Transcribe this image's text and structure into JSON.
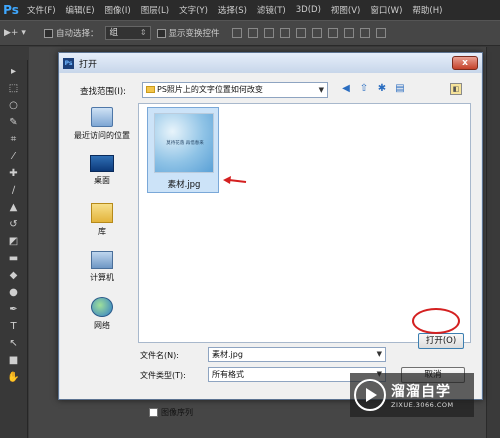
{
  "app": {
    "logo": "Ps",
    "menu": [
      "文件(F)",
      "编辑(E)",
      "图像(I)",
      "图层(L)",
      "文字(Y)",
      "选择(S)",
      "滤镜(T)",
      "3D(D)",
      "视图(V)",
      "窗口(W)",
      "帮助(H)"
    ]
  },
  "options": {
    "tool": "▶+ ▾",
    "auto_select_label": "自动选择：",
    "auto_select_value": "组",
    "show_transform_label": "显示变换控件"
  },
  "tools": [
    "move-icon",
    "marquee-icon",
    "lasso-icon",
    "quick-select-icon",
    "crop-icon",
    "eyedropper-icon",
    "healing-icon",
    "brush-icon",
    "stamp-icon",
    "history-brush-icon",
    "eraser-icon",
    "gradient-icon",
    "blur-icon",
    "dodge-icon",
    "pen-icon",
    "type-icon",
    "path-select-icon",
    "shape-icon",
    "hand-icon"
  ],
  "dialog": {
    "title": "打开",
    "close": "x",
    "look_in_label": "查找范围(I):",
    "look_in_value": "PS照片上的文字位置如何改变",
    "places": [
      {
        "label": "最近访问的位置",
        "icon": "recent-places-icon"
      },
      {
        "label": "桌面",
        "icon": "desktop-icon"
      },
      {
        "label": "库",
        "icon": "library-icon"
      },
      {
        "label": "计算机",
        "icon": "computer-icon"
      },
      {
        "label": "网络",
        "icon": "network-icon"
      }
    ],
    "file": {
      "name": "素材.jpg",
      "thumb_text": "莫待花落 再惜春来"
    },
    "filename_label": "文件名(N):",
    "filename_value": "素材.jpg",
    "filetype_label": "文件类型(T):",
    "filetype_value": "所有格式",
    "open_button": "打开(O)",
    "cancel_button": "取消",
    "image_sequence_label": "图像序列"
  },
  "watermark": {
    "name": "溜溜自学",
    "url": "ZIXUE.3066.COM"
  }
}
